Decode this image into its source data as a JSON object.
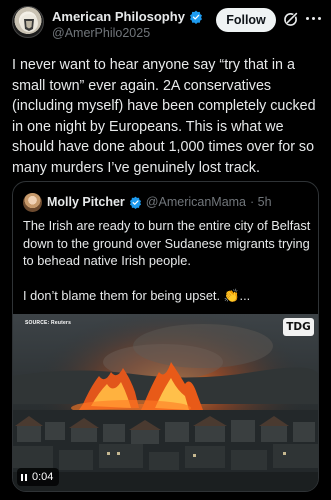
{
  "post": {
    "author_name": "American Philosophy",
    "handle": "@AmerPhilo2025",
    "follow_label": "Follow",
    "text": "I never want to hear anyone say “try that in a small town” ever again. 2A conservatives (including myself) have been completely cucked in one night by Europeans. This is what we should have done about 1,000 times over for so many murders I’ve genuinely lost track."
  },
  "quoted": {
    "author_name": "Molly Pitcher",
    "handle": "@AmericanMama",
    "time": "· 5h",
    "text": "The Irish are ready to burn the entire city of Belfast down to the ground over Sudanese migrants trying to behead native Irish people.",
    "text2": "I don’t blame them for being upset. 👏..."
  },
  "video": {
    "source_label": "SOURCE: Reuters",
    "logo_text": "TDG",
    "timer": "0:04"
  },
  "colors": {
    "verified_blue": "#1d9bf0",
    "background": "#000000",
    "fire_orange": "#ff6a1a"
  },
  "icons": [
    "verified-badge-icon",
    "grok-icon",
    "more-icon",
    "pause-icon"
  ]
}
